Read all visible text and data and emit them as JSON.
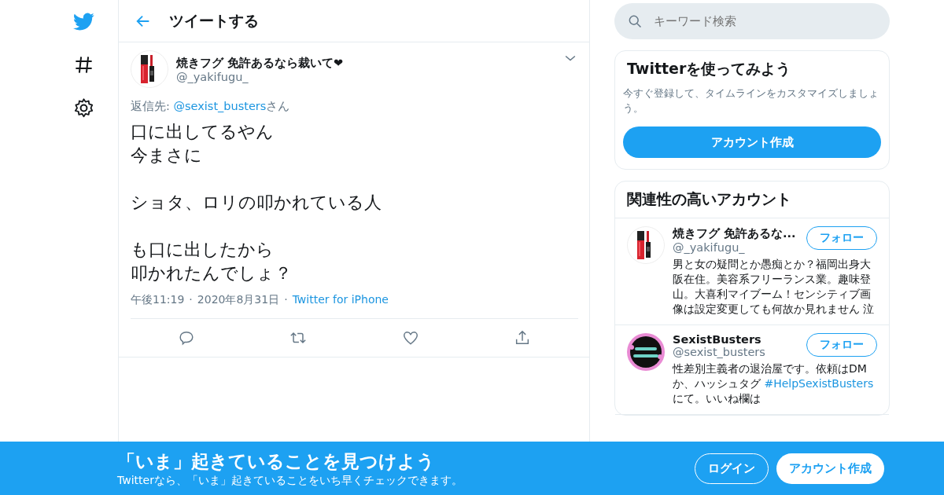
{
  "nav": {
    "items": [
      {
        "kind": "logo"
      },
      {
        "kind": "explore"
      },
      {
        "kind": "settings"
      }
    ]
  },
  "search": {
    "placeholder": "キーワード検索"
  },
  "header": {
    "title": "ツイートする"
  },
  "tweet": {
    "name": "焼きフグ 免許あるなら裁いて❤",
    "handle": "@_yakifugu_",
    "reply_to": [
      {
        "kind": "text",
        "text": "返信先: "
      },
      {
        "kind": "link",
        "text": "@sexist_busters"
      },
      {
        "kind": "text",
        "text": "さん"
      }
    ],
    "body": [
      [
        "口に出してるやん",
        "今まさに"
      ],
      [
        "ショタ、ロリの叩かれている人"
      ],
      [
        "も口に出したから",
        "叩かれたんでしょ？"
      ]
    ],
    "time": "午後11:19",
    "date": "2020年8月31日",
    "separator": "·",
    "source": "Twitter for iPhone",
    "actions": [
      {
        "kind": "reply"
      },
      {
        "kind": "retweet"
      },
      {
        "kind": "like"
      },
      {
        "kind": "share"
      }
    ]
  },
  "signup": {
    "title": "Twitterを使ってみよう",
    "text": "今すぐ登録して、タイムラインをカスタマイズしましょう。",
    "button": "アカウント作成"
  },
  "related": {
    "title": "関連性の高いアカウント",
    "accounts": [
      {
        "name": "焼きフグ 免許あるな...",
        "handle": "@_yakifugu_",
        "follow": "フォロー",
        "kind": "lipstick",
        "bio": [
          {
            "kind": "text",
            "text": "男と女の疑問とか愚痴とか？福岡出身大阪在住。美容系フリーランス業。趣味登山。大喜利マイブーム！センシティブ画像は設定変更しても何故か見れません 泣"
          }
        ]
      },
      {
        "name": "SexistBusters",
        "handle": "@sexist_busters",
        "follow": "フォロー",
        "kind": "badge",
        "bio": [
          {
            "kind": "text",
            "text": "性差別主義者の退治屋です。依頼はDMか、ハッシュタグ "
          },
          {
            "kind": "link",
            "text": "#HelpSexistBusters"
          },
          {
            "kind": "text",
            "text": " にて。いいね欄は"
          }
        ]
      }
    ]
  },
  "banner": {
    "title": "「いま」起きていることを見つけよう",
    "subtitle": "Twitterなら、「いま」起きていることをいち早くチェックできます。",
    "login": "ログイン",
    "signup": "アカウント作成"
  }
}
